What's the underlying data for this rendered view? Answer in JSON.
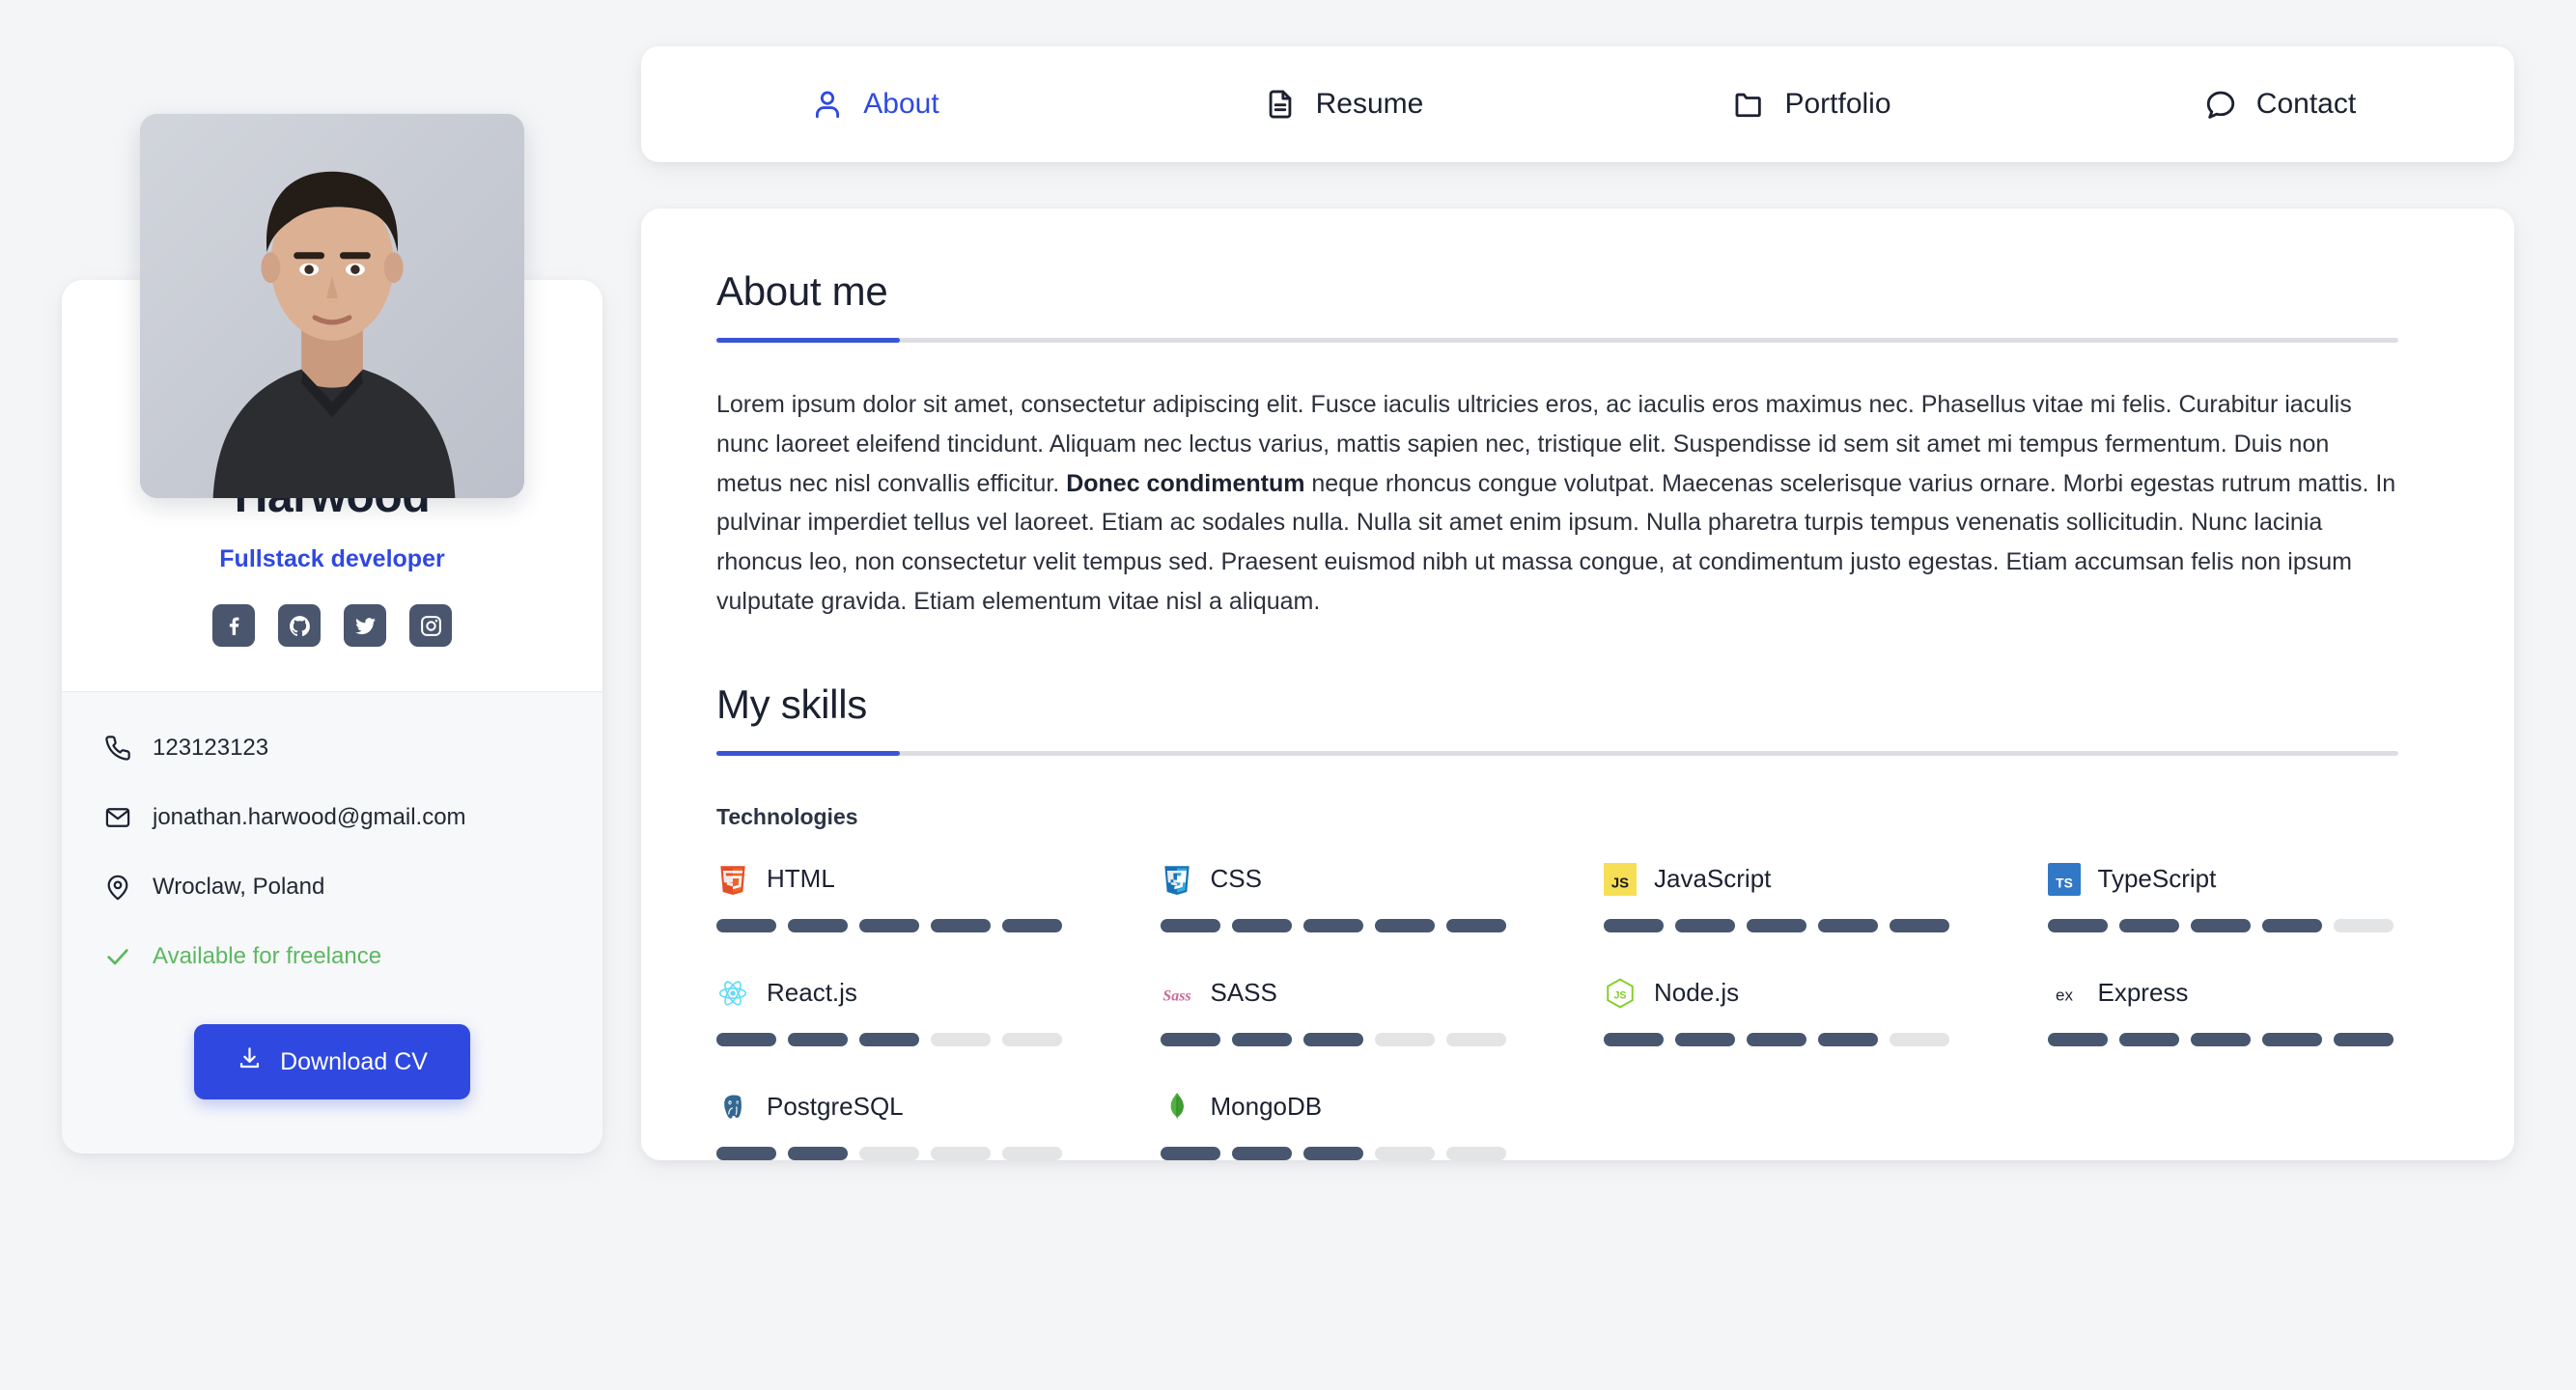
{
  "theme": {
    "accent": "#2f49e0",
    "accent_dark": "#3a54d6",
    "bar_filled": "#48576f",
    "bar_empty": "#e3e4e6",
    "page_bg": "#f4f5f7",
    "card_bg": "#ffffff",
    "text": "#1b2130",
    "available_green": "#5cb860"
  },
  "sidebar": {
    "avatar_alt": "profile-photo",
    "name": "Jonathan Harwood",
    "role": "Fullstack developer",
    "socials": [
      {
        "name": "facebook",
        "icon": "facebook-icon"
      },
      {
        "name": "github",
        "icon": "github-icon"
      },
      {
        "name": "twitter",
        "icon": "twitter-icon"
      },
      {
        "name": "instagram",
        "icon": "instagram-icon"
      }
    ],
    "contacts": [
      {
        "icon": "phone-icon",
        "value": "123123123"
      },
      {
        "icon": "mail-icon",
        "value": "jonathan.harwood@gmail.com"
      },
      {
        "icon": "location-pin-icon",
        "value": "Wroclaw, Poland"
      },
      {
        "icon": "check-icon",
        "value": "Available for freelance"
      }
    ],
    "download_cv_label": "Download CV"
  },
  "nav": {
    "items": [
      {
        "label": "About",
        "icon": "user-icon",
        "active": true
      },
      {
        "label": "Resume",
        "icon": "document-icon",
        "active": false
      },
      {
        "label": "Portfolio",
        "icon": "folder-icon",
        "active": false
      },
      {
        "label": "Contact",
        "icon": "chat-bubble-icon",
        "active": false
      }
    ]
  },
  "about": {
    "heading": "About me",
    "paragraph_part1": "Lorem ipsum dolor sit amet, consectetur adipiscing elit. Fusce iaculis ultricies eros, ac iaculis eros maximus nec. Phasellus vitae mi felis. Curabitur iaculis nunc laoreet eleifend tincidunt. Aliquam nec lectus varius, mattis sapien nec, tristique elit. Suspendisse id sem sit amet mi tempus fermentum. Duis non metus nec nisl convallis efficitur. ",
    "paragraph_bold": "Donec condimentum",
    "paragraph_part2": " neque rhoncus congue volutpat. Maecenas scelerisque varius ornare. Morbi egestas rutrum mattis. In pulvinar imperdiet tellus vel laoreet. Etiam ac sodales nulla. Nulla sit amet enim ipsum. Nulla pharetra turpis tempus venenatis sollicitudin. Nunc lacinia rhoncus leo, non consectetur velit tempus sed. Praesent euismod nibh ut massa congue, at condimentum justo egestas. Etiam accumsan felis non ipsum vulputate gravida. Etiam elementum vitae nisl a aliquam."
  },
  "skills": {
    "heading": "My skills",
    "group_label": "Technologies",
    "max_level": 5,
    "items": [
      {
        "name": "HTML",
        "icon": "html5-logo",
        "level": 5
      },
      {
        "name": "CSS",
        "icon": "css3-logo",
        "level": 5
      },
      {
        "name": "JavaScript",
        "icon": "javascript-logo",
        "level": 5
      },
      {
        "name": "TypeScript",
        "icon": "typescript-logo",
        "level": 4
      },
      {
        "name": "React.js",
        "icon": "react-logo",
        "level": 3
      },
      {
        "name": "SASS",
        "icon": "sass-logo",
        "level": 3
      },
      {
        "name": "Node.js",
        "icon": "nodejs-logo",
        "level": 4
      },
      {
        "name": "Express",
        "icon": "express-logo",
        "level": 5
      },
      {
        "name": "PostgreSQL",
        "icon": "postgresql-logo",
        "level": 2
      },
      {
        "name": "MongoDB",
        "icon": "mongodb-logo",
        "level": 3
      }
    ]
  }
}
